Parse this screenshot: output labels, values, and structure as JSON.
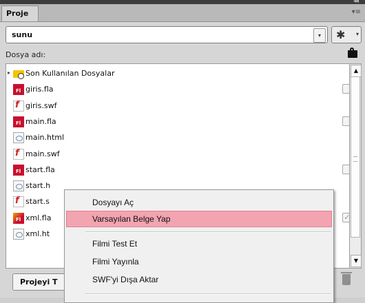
{
  "window": {
    "collapse_glyph": "◂◂"
  },
  "tab": {
    "label": "Proje",
    "panel_menu_glyph": "▾≡"
  },
  "project_selector": {
    "value": "sunu",
    "dropdown_glyph": "▾"
  },
  "settings": {
    "gear_glyph": "✱",
    "dropdown_glyph": "▾"
  },
  "list_header": {
    "label": "Dosya adı:"
  },
  "files": [
    {
      "name": "Son Kullanılan Dosyalar",
      "type": "folder",
      "checkbox": false
    },
    {
      "name": "giris.fla",
      "type": "fla",
      "checkbox": true,
      "checked": false
    },
    {
      "name": "giris.swf",
      "type": "swf",
      "checkbox": false
    },
    {
      "name": "main.fla",
      "type": "fla",
      "checkbox": true,
      "checked": false
    },
    {
      "name": "main.html",
      "type": "html",
      "checkbox": false
    },
    {
      "name": "main.swf",
      "type": "swf",
      "checkbox": false
    },
    {
      "name": "start.fla",
      "type": "fla",
      "checkbox": true,
      "checked": false
    },
    {
      "name": "start.h",
      "type": "html",
      "checkbox": false
    },
    {
      "name": "start.s",
      "type": "swf",
      "checkbox": false
    },
    {
      "name": "xml.fla",
      "type": "fla-xml",
      "checkbox": true,
      "checked": true
    },
    {
      "name": "xml.ht",
      "type": "html",
      "checkbox": false
    }
  ],
  "bottom": {
    "test_project_label": "Projeyi T"
  },
  "context_menu": {
    "items": [
      "Dosyayı Aç",
      "Varsayılan Belge Yap",
      "Filmi Test Et",
      "Filmi Yayınla",
      "SWF'yi Dışa Aktar"
    ],
    "highlighted_index": 1
  },
  "colors": {
    "highlight": "#f2a4b0",
    "fla_icon": "#c8102e",
    "folder": "#f5c400"
  }
}
